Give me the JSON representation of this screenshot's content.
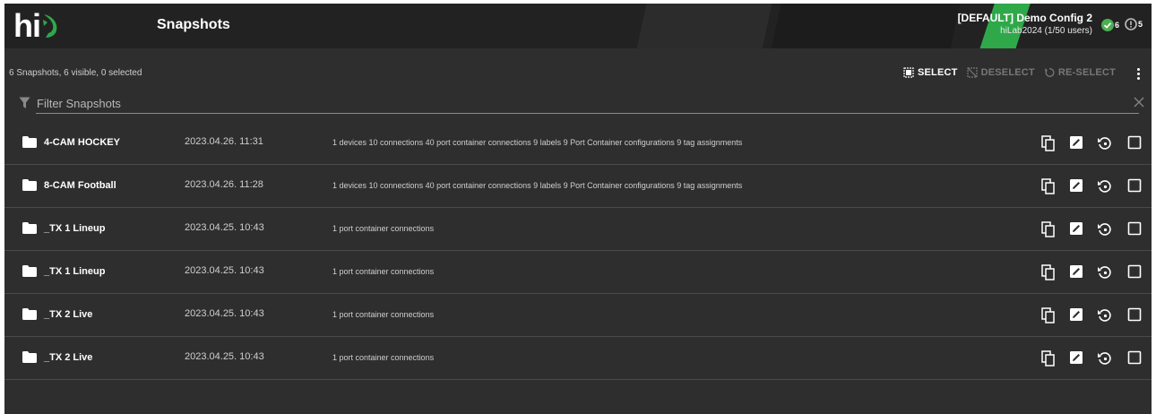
{
  "header": {
    "logo_text": "hi",
    "title": "Snapshots",
    "config_name": "[DEFAULT] Demo Config 2",
    "config_users": "hiLab2024 (1/50 users)",
    "status_ok_count": "6",
    "status_alert_count": "5",
    "accent_color": "#2fa84a"
  },
  "toolbar": {
    "summary": "6 Snapshots, 6 visible, 0 selected",
    "select_label": "SELECT",
    "deselect_label": "DESELECT",
    "reselect_label": "RE-SELECT"
  },
  "filter": {
    "placeholder": "Filter Snapshots",
    "value": ""
  },
  "snapshots": [
    {
      "name": "4-CAM HOCKEY",
      "date": "2023.04.26. 11:31",
      "description": "1 devices 10 connections 40 port container connections 9 labels 9 Port Container configurations 9 tag assignments"
    },
    {
      "name": "8-CAM Football",
      "date": "2023.04.26. 11:28",
      "description": "1 devices 10 connections 40 port container connections 9 labels 9 Port Container configurations 9 tag assignments"
    },
    {
      "name": "_TX 1 Lineup",
      "date": "2023.04.25. 10:43",
      "description": "1 port container connections"
    },
    {
      "name": "_TX 1 Lineup",
      "date": "2023.04.25. 10:43",
      "description": "1 port container connections"
    },
    {
      "name": "_TX 2 Live",
      "date": "2023.04.25. 10:43",
      "description": "1 port container connections"
    },
    {
      "name": "_TX 2 Live",
      "date": "2023.04.25. 10:43",
      "description": "1 port container connections"
    }
  ],
  "icons": {
    "row_actions": [
      "copy-icon",
      "edit-icon",
      "restore-icon",
      "checkbox-icon"
    ],
    "toolbar": [
      "select-all-icon",
      "deselect-icon",
      "reselect-icon",
      "more-vert-icon"
    ],
    "filter": [
      "filter-icon",
      "clear-icon"
    ]
  }
}
